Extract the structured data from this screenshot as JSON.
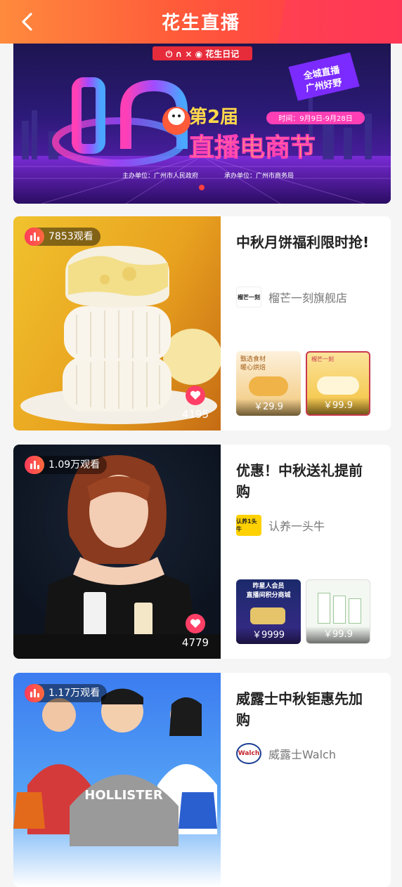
{
  "header": {
    "title": "花生直播"
  },
  "banner": {
    "logos_text": "花生日记",
    "badge_line1": "全城直播",
    "badge_line2": "广州好野",
    "edition": "第2届",
    "time": "时间：9月9日-9月28日",
    "event_name": "直播电商节",
    "organizer": "主办单位：广州市人民政府",
    "co_organizer": "承办单位：广州市商务局"
  },
  "cards": [
    {
      "views": "7853观看",
      "likes": "4195",
      "title": "中秋月饼福利限时抢!",
      "store": "榴芒一刻旗舰店",
      "store_logo": "榴芒一刻",
      "thumbs": [
        {
          "caption1": "甄选食材",
          "caption2": "暖心烘焙",
          "price": "￥29.9"
        },
        {
          "caption1": "榴芒一刻",
          "caption2": "",
          "price": "￥99.9"
        }
      ]
    },
    {
      "views": "1.09万观看",
      "likes": "4779",
      "title": "优惠！中秋送礼提前购",
      "store": "认养一头牛",
      "store_logo": "认养1头牛",
      "thumbs": [
        {
          "caption1": "昨星人会员",
          "caption2": "直播间积分商城",
          "price": "￥9999"
        },
        {
          "caption1": "",
          "caption2": "",
          "price": "￥99.9"
        }
      ]
    },
    {
      "views": "1.17万观看",
      "likes": "",
      "title": "威露士中秋钜惠先加购",
      "store": "威露士Walch",
      "store_logo": "Walch",
      "shirt_text": "HOLLISTER"
    }
  ],
  "colors": {
    "accent": "#ff3f66",
    "header_start": "#ff8a3d",
    "header_end": "#ff2f4f"
  }
}
